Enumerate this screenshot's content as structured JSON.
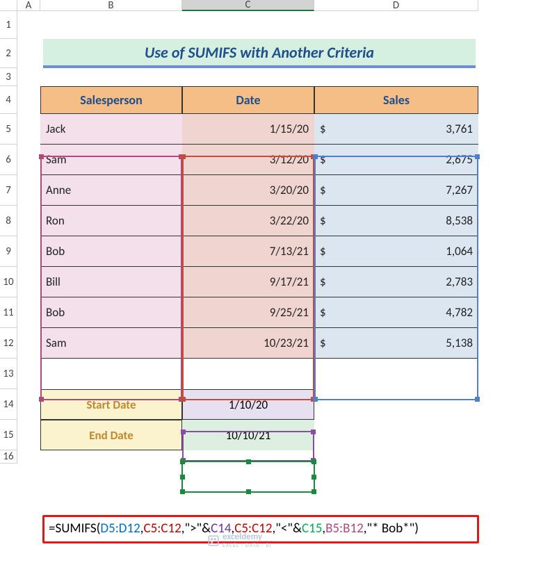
{
  "columns": [
    "A",
    "B",
    "C",
    "D"
  ],
  "rows": [
    "1",
    "2",
    "3",
    "4",
    "5",
    "6",
    "7",
    "8",
    "9",
    "10",
    "11",
    "12",
    "13",
    "14",
    "15",
    "16"
  ],
  "title": "Use of SUMIFS with Another Criteria",
  "headers": {
    "b": "Salesperson",
    "c": "Date",
    "d": "Sales"
  },
  "data": [
    {
      "person": "Jack",
      "date": "1/15/20",
      "currency": "$",
      "sales": "3,761"
    },
    {
      "person": "Sam",
      "date": "3/12/20",
      "currency": "$",
      "sales": "2,675"
    },
    {
      "person": "Anne",
      "date": "3/20/20",
      "currency": "$",
      "sales": "7,267"
    },
    {
      "person": "Ron",
      "date": "3/22/20",
      "currency": "$",
      "sales": "8,538"
    },
    {
      "person": "Bob",
      "date": "7/13/21",
      "currency": "$",
      "sales": "1,064"
    },
    {
      "person": "Bill",
      "date": "9/17/21",
      "currency": "$",
      "sales": "2,783"
    },
    {
      "person": "Bob",
      "date": "9/25/21",
      "currency": "$",
      "sales": "4,782"
    },
    {
      "person": "Sam",
      "date": "10/23/21",
      "currency": "$",
      "sales": "5,138"
    }
  ],
  "criteria": {
    "start_label": "Start Date",
    "end_label": "End Date",
    "start_value": "1/10/20",
    "end_value": "10/10/21"
  },
  "formula": {
    "p1": "=SUMIFS(",
    "r1": "D5:D12",
    "c1": ",",
    "r2": "C5:C12",
    "c2": ",\">\"&",
    "r3": "C14",
    "c3": ",",
    "r4": "C5:C12",
    "c4": ",\"<\"&",
    "r5": "C15",
    "c5": ",",
    "r6": "B5:B12",
    "c6": ",\"* Bob*\")"
  },
  "watermark": {
    "name": "exceldemy",
    "sub": "EXCEL · DATA · BI"
  },
  "colors": {
    "range_blue": "#4d7ecf",
    "range_red": "#c44d3a",
    "range_purple": "#8b4ba8",
    "range_green": "#1a8a3f",
    "range_magenta": "#b0487c"
  }
}
